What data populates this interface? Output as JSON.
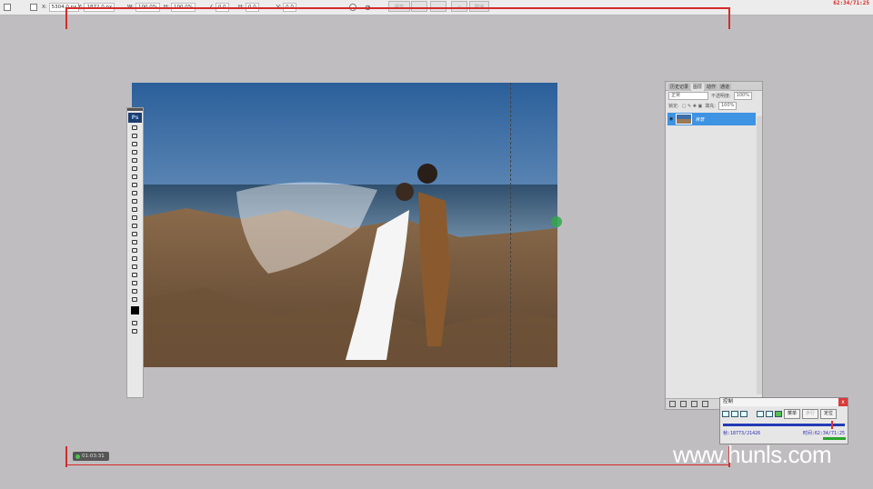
{
  "options_bar": {
    "x_label": "X:",
    "x_value": "5304.0 px",
    "y_label": "Y:",
    "y_value": "1872.0 px",
    "w_label": "W:",
    "w_value": "100.0%",
    "h_label": "H:",
    "h_value": "100.0%",
    "angle_value": "0.0",
    "hskew_label": "H:",
    "hskew_value": "0.0",
    "vskew_label": "V:",
    "vskew_value": "0.0",
    "commit_label": "提交",
    "cancel_label": "取消"
  },
  "clock": "62:34/71:25",
  "layers_panel": {
    "tabs": [
      "历史记录",
      "图层",
      "动作",
      "通道"
    ],
    "active_tab": 1,
    "blend_mode": "正常",
    "opacity_label": "不透明度:",
    "opacity_value": "100%",
    "lock_label": "锁定:",
    "fill_label": "填充:",
    "fill_value": "100%",
    "layer_name": "背景"
  },
  "tools_panel": {
    "logo": "Ps"
  },
  "control_panel": {
    "title": "控制",
    "close": "x",
    "menu_label": "菜单",
    "step_label": "步行",
    "locate_label": "定位",
    "frame_label": "帧:18773/21426",
    "time_label": "时间:62:34/71:25"
  },
  "timer": "01:03:31",
  "watermark": "www.hunls.com",
  "colors": {
    "frame_red": "#d52a2a",
    "layer_selected": "#3f93e3",
    "canvas_bg": "#c0bdc0"
  }
}
